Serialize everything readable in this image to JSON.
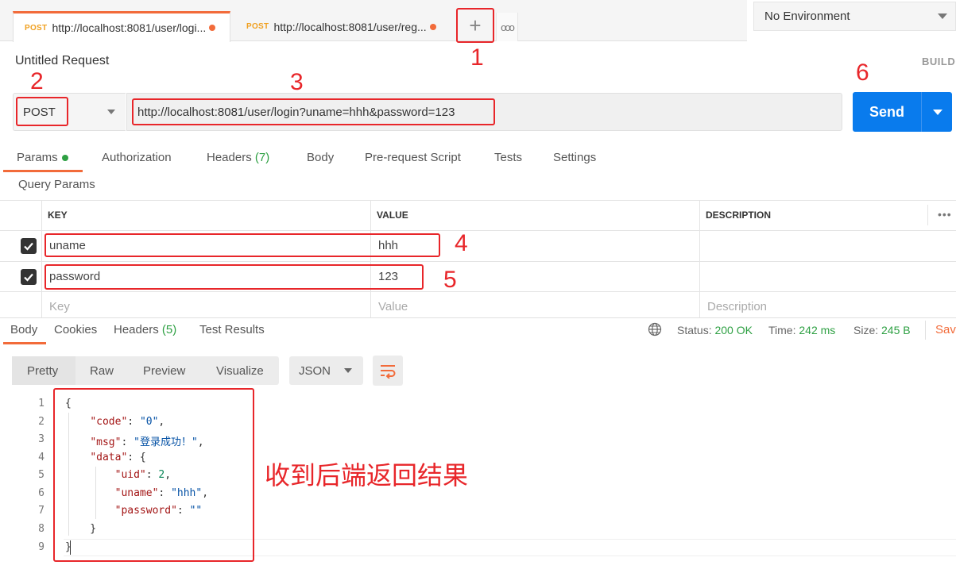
{
  "tabs": [
    {
      "method": "POST",
      "url": "http://localhost:8081/user/logi..."
    },
    {
      "method": "POST",
      "url": "http://localhost:8081/user/reg..."
    }
  ],
  "new_tab_label": "+",
  "more_tabs_label": "ooo",
  "environment": {
    "selected": "No Environment"
  },
  "request": {
    "title": "Untitled Request",
    "build_label": "BUILD",
    "method": "POST",
    "url": "http://localhost:8081/user/login?uname=hhh&password=123",
    "send_label": "Send"
  },
  "request_tabs": [
    {
      "label": "Params"
    },
    {
      "label": "Authorization"
    },
    {
      "label": "Headers",
      "count": "(7)"
    },
    {
      "label": "Body"
    },
    {
      "label": "Pre-request Script"
    },
    {
      "label": "Tests"
    },
    {
      "label": "Settings"
    }
  ],
  "query_params": {
    "title": "Query Params",
    "headers": {
      "key": "KEY",
      "value": "VALUE",
      "description": "DESCRIPTION"
    },
    "rows": [
      {
        "checked": true,
        "key": "uname",
        "value": "hhh"
      },
      {
        "checked": true,
        "key": "password",
        "value": "123"
      }
    ],
    "placeholder": {
      "key": "Key",
      "value": "Value",
      "description": "Description"
    }
  },
  "response_tabs": [
    {
      "label": "Body"
    },
    {
      "label": "Cookies"
    },
    {
      "label": "Headers",
      "count": "(5)"
    },
    {
      "label": "Test Results"
    }
  ],
  "response_status": {
    "status_label": "Status:",
    "status_value": "200 OK",
    "time_label": "Time:",
    "time_value": "242 ms",
    "size_label": "Size:",
    "size_value": "245 B",
    "save_label": "Sav"
  },
  "view_modes": [
    "Pretty",
    "Raw",
    "Preview",
    "Visualize"
  ],
  "format": "JSON",
  "response_body": {
    "line_numbers": [
      "1",
      "2",
      "3",
      "4",
      "5",
      "6",
      "7",
      "8",
      "9"
    ],
    "code": "0",
    "msg": "登录成功！",
    "uid": 2,
    "uname": "hhh",
    "password": ""
  },
  "annotations": {
    "n1": "1",
    "n2": "2",
    "n3": "3",
    "n4": "4",
    "n5": "5",
    "n6": "6",
    "result_note": "收到后端返回结果"
  },
  "colors": {
    "accent": "#f26b3a",
    "send_button": "#097bed",
    "success": "#2ea043",
    "annotation_red": "#e8262a"
  }
}
